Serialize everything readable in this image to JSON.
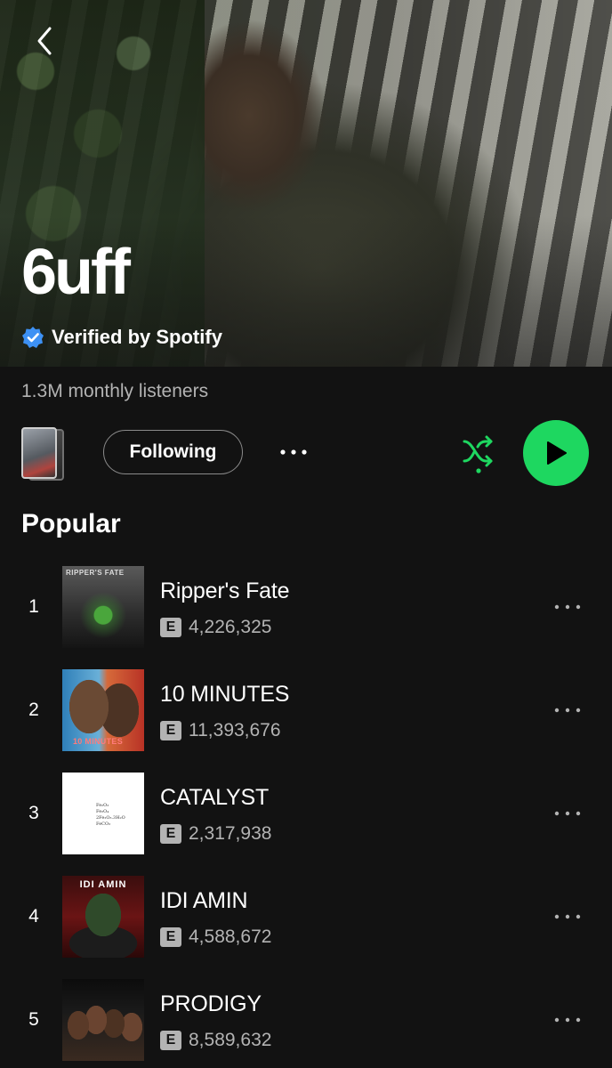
{
  "artist": {
    "name": "6uff",
    "verified_label": "Verified by Spotify",
    "monthly_listeners": "1.3M monthly listeners"
  },
  "controls": {
    "following_label": "Following",
    "more_label": "•••"
  },
  "popular": {
    "title": "Popular",
    "tracks": [
      {
        "number": "1",
        "title": "Ripper's Fate",
        "explicit": "E",
        "plays": "4,226,325",
        "art_text": "RIPPER'S FATE"
      },
      {
        "number": "2",
        "title": "10 MINUTES",
        "explicit": "E",
        "plays": "11,393,676",
        "art_text": "10 MINUTES"
      },
      {
        "number": "3",
        "title": "CATALYST",
        "explicit": "E",
        "plays": "2,317,938",
        "art_text": "Fe₂O₃\nFe₃O₄\n2Fe₂O₃.3H₂O\nFeCO₃"
      },
      {
        "number": "4",
        "title": "IDI AMIN",
        "explicit": "E",
        "plays": "4,588,672",
        "art_text": "IDI AMIN"
      },
      {
        "number": "5",
        "title": "PRODIGY",
        "explicit": "E",
        "plays": "8,589,632",
        "art_text": ""
      }
    ],
    "track_more_label": "•••"
  },
  "colors": {
    "accent": "#1ed760",
    "background": "#121212",
    "secondary_text": "#b3b3b3"
  },
  "icons": {
    "back": "chevron-left-icon",
    "verified": "verified-badge-icon",
    "more": "more-horizontal-icon",
    "shuffle": "shuffle-icon",
    "play": "play-icon"
  }
}
